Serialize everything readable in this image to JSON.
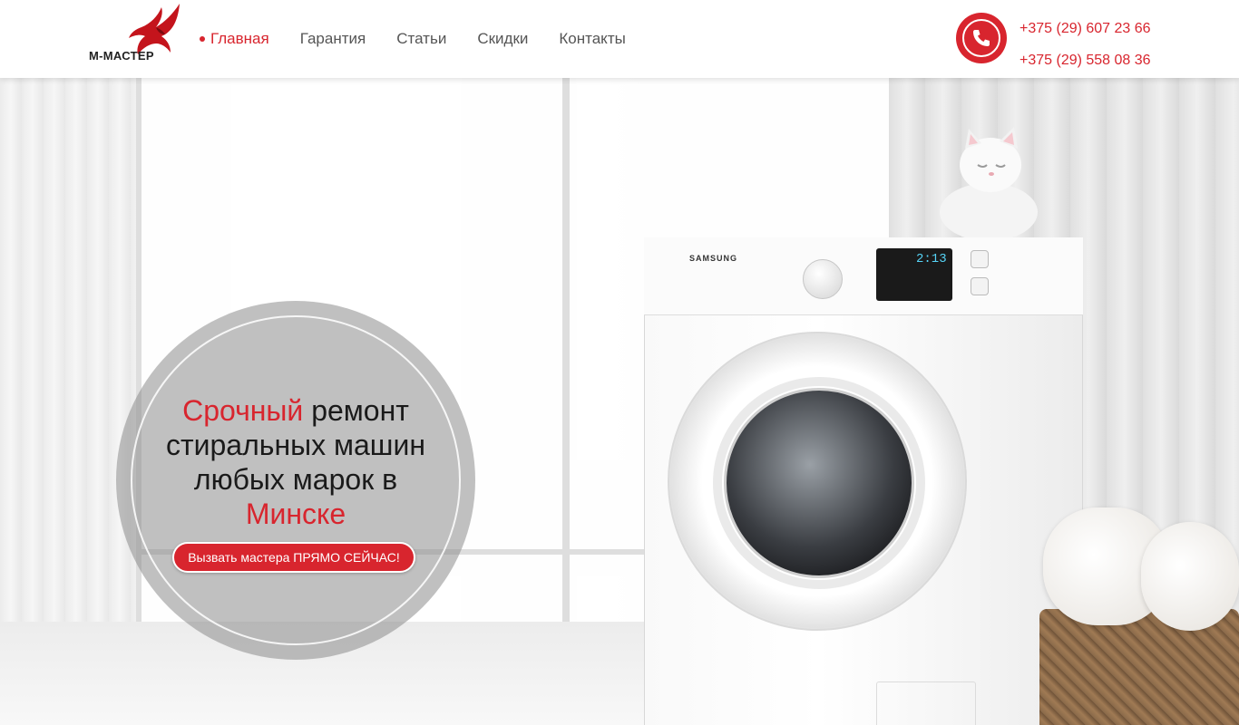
{
  "header": {
    "logo_text": "М-МАСТЕР",
    "nav": [
      {
        "label": "Главная",
        "active": true
      },
      {
        "label": "Гарантия",
        "active": false
      },
      {
        "label": "Статьи",
        "active": false
      },
      {
        "label": "Скидки",
        "active": false
      },
      {
        "label": "Контакты",
        "active": false
      }
    ],
    "phones": [
      "+375 (29) 607 23 66",
      "+375 (29) 558 08 36"
    ]
  },
  "hero": {
    "title_part1": "Срочный",
    "title_part2": " ремонт стиральных машин любых марок в ",
    "title_part3": "Минске",
    "cta_label": "Вызвать мастера ПРЯМО СЕЙЧАС!",
    "washer_brand": "SAMSUNG",
    "washer_display": "2:13"
  },
  "colors": {
    "accent": "#d8252e",
    "text": "#1a1a1a"
  }
}
